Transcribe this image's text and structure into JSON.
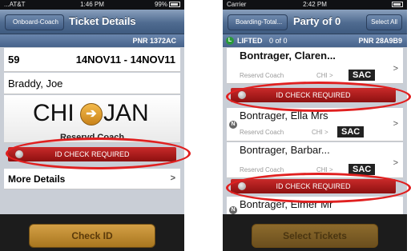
{
  "left": {
    "status": {
      "carrier": "...AT&T",
      "time": "1:46 PM",
      "battery": "99%"
    },
    "nav": {
      "back": "Onboard-Coach",
      "title": "Ticket Details"
    },
    "pnr": "PNR 1372AC",
    "train": {
      "number": "59",
      "dates": "14NOV11 - 14NOV11"
    },
    "passenger": "Braddy, Joe",
    "route": {
      "from": "CHI",
      "to": "JAN"
    },
    "coach": "Reservd Coach",
    "alert": "ID CHECK REQUIRED",
    "more": "More Details",
    "more_chevron": ">",
    "action": "Check ID"
  },
  "right": {
    "status": {
      "carrier": "Carrier",
      "time": "2:42 PM"
    },
    "nav": {
      "back": "Boarding-Total...",
      "title": "Party of 0",
      "select_all": "Select All"
    },
    "lifted": {
      "label": "LIFTED",
      "count": "0 of 0",
      "pnr": "PNR 28A9B9"
    },
    "passengers": [
      {
        "name": "Bontrager, Claren...",
        "class": "Reservd Coach",
        "city": "CHI >",
        "dest": "SAC"
      },
      {
        "name": "Bontrager, Ella Mrs",
        "class": "Reservd Coach",
        "city": "CHI >",
        "dest": "SAC",
        "badge": "N"
      },
      {
        "name": "Bontrager, Barbar...",
        "class": "Reservd Coach",
        "city": "CHI >",
        "dest": "SAC"
      },
      {
        "name": "Bontrager, Elmer Mr",
        "badge": "N"
      }
    ],
    "alert": "ID CHECK REQUIRED",
    "row_chevron": ">",
    "action": "Select Tickets"
  },
  "colors": {
    "alert_red": "#b31b1b",
    "highlight_oval": "#e02020",
    "nav_blue": "#4f6b90",
    "button_gold": "#c08a32"
  }
}
